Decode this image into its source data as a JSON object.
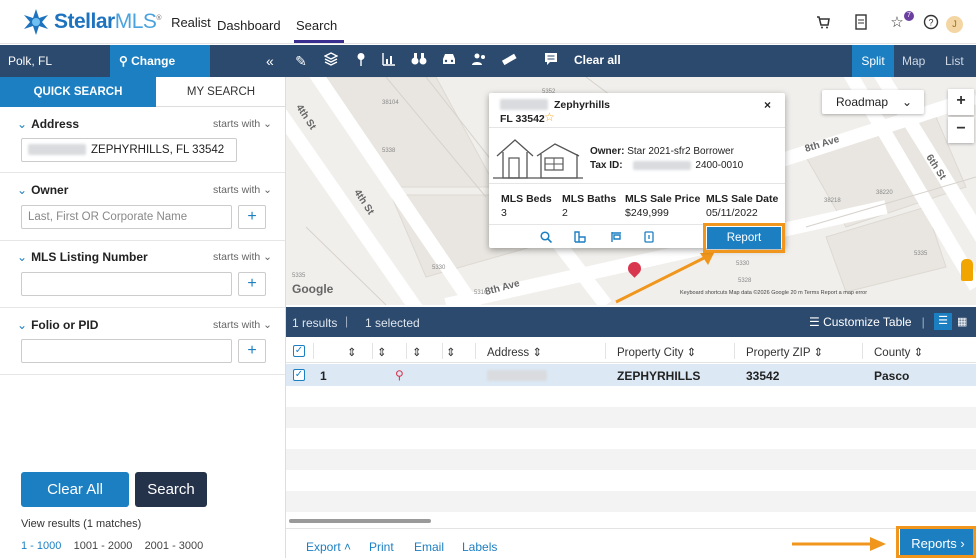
{
  "header": {
    "brand_stellar": "Stellar",
    "brand_mls": "MLS",
    "product": "Realist",
    "nav": [
      "Dashboard",
      "Search"
    ],
    "notifications_count": "7",
    "avatar_initial": "J"
  },
  "left_panel": {
    "county": "Polk, FL",
    "change_county": "Change County",
    "collapse": "«",
    "tabs": [
      "QUICK SEARCH",
      "MY SEARCH"
    ],
    "address": {
      "label": "Address",
      "mode": "starts with",
      "value": "ZEPHYRHILLS, FL 33542"
    },
    "owner": {
      "label": "Owner",
      "mode": "starts with",
      "placeholder": "Last, First OR Corporate Name"
    },
    "mls": {
      "label": "MLS Listing Number",
      "mode": "starts with"
    },
    "folio": {
      "label": "Folio or PID",
      "mode": "starts with"
    },
    "clear_all": "Clear All",
    "search": "Search",
    "view_results": "View results",
    "matches": "(1 matches)",
    "pages": [
      "1 - 1000",
      "1001 - 2000",
      "2001 - 3000"
    ]
  },
  "toolbar": {
    "clear_all": "Clear all",
    "views": [
      "Split",
      "Map",
      "List"
    ]
  },
  "map": {
    "street_labels": [
      "4th St",
      "4th St",
      "8th Ave",
      "8th Ave",
      "6th St",
      "6th St",
      "8th Ave"
    ],
    "parcel_numbers": [
      "38104",
      "5338",
      "5335",
      "5330",
      "5316",
      "5352",
      "38220",
      "38218",
      "5335",
      "5330",
      "5328"
    ],
    "roadmap": "Roadmap",
    "google": "Google",
    "footer": "Keyboard shortcuts   Map data ©2026 Google   20 m         Terms   Report a map error"
  },
  "popup": {
    "city": "Zephyrhills",
    "zip": "FL 33542",
    "owner_label": "Owner:",
    "owner": "Star 2021-sfr2 Borrower",
    "taxid_label": "Tax ID:",
    "taxid_suffix": "2400-0010",
    "stats": [
      {
        "label": "MLS Beds",
        "value": "3"
      },
      {
        "label": "MLS Baths",
        "value": "2"
      },
      {
        "label": "MLS Sale Price",
        "value": "$249,999"
      },
      {
        "label": "MLS Sale Date",
        "value": "05/11/2022"
      }
    ],
    "report": "Report",
    "close": "×"
  },
  "results": {
    "count": "1 results",
    "selected": "1 selected",
    "customize": "Customize Table",
    "columns": [
      "Address",
      "Property City",
      "Property ZIP",
      "County"
    ],
    "rows": [
      {
        "index": "1",
        "city": "ZEPHYRHILLS",
        "zip": "33542",
        "county": "Pasco"
      }
    ]
  },
  "bottom": {
    "export": "Export",
    "print": "Print",
    "email": "Email",
    "labels": "Labels",
    "reports": "Reports"
  },
  "colors": {
    "navy": "#2c4a6e",
    "accent": "#1c7fc2",
    "highlight": "#f0961c"
  }
}
